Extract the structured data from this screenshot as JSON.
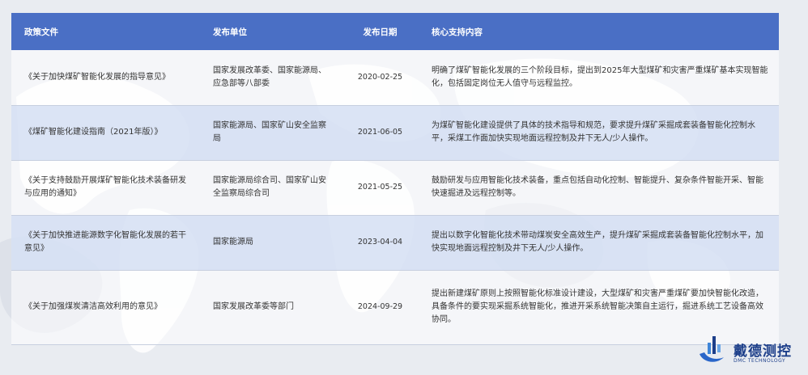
{
  "table": {
    "headers": {
      "policy": "政策文件",
      "issuer": "发布单位",
      "date": "发布日期",
      "content": "核心支持内容"
    },
    "rows": [
      {
        "policy": "《关于加快煤矿智能化发展的指导意见》",
        "issuer": "国家发展改革委、国家能源局、应急部等八部委",
        "date": "2020-02-25",
        "content": "明确了煤矿智能化发展的三个阶段目标，提出到2025年大型煤矿和灾害严重煤矿基本实现智能化，包括固定岗位无人值守与远程监控。"
      },
      {
        "policy": "《煤矿智能化建设指南（2021年版）》",
        "issuer": "国家能源局、国家矿山安全监察局",
        "date": "2021-06-05",
        "content": "为煤矿智能化建设提供了具体的技术指导和规范，要求提升煤矿采掘成套装备智能化控制水平，采煤工作面加快实现地面远程控制及井下无人/少人操作。"
      },
      {
        "policy": "《关于支持鼓励开展煤矿智能化技术装备研发与应用的通知》",
        "issuer": "国家能源局综合司、国家矿山安全监察局综合司",
        "date": "2021-05-25",
        "content": "鼓励研发与应用智能化技术装备，重点包括自动化控制、智能提升、复杂条件智能开采、智能快速掘进及远程控制等。"
      },
      {
        "policy": "《关于加快推进能源数字化智能化发展的若干意见》",
        "issuer": "国家能源局",
        "date": "2023-04-04",
        "content": "提出以数字化智能化技术带动煤炭安全高效生产，提升煤矿采掘成套装备智能化控制水平，加快实现地面远程控制及井下无人/少人操作。"
      },
      {
        "policy": "《关于加强煤炭清洁高效利用的意见》",
        "issuer": "国家发展改革委等部门",
        "date": "2024-09-29",
        "content": "提出新建煤矿原则上按照智能化标准设计建设，大型煤矿和灾害严重煤矿要加快智能化改造，具备条件的要实现采掘系统智能化，推进开采系统智能决策自主运行，掘进系统工艺设备高效协同。"
      }
    ]
  },
  "logo": {
    "name": "戴德测控",
    "subtitle": "DMC TECHNOLOGY"
  },
  "colors": {
    "header_bg": "#4a6fc5",
    "row_alt_bg": "#d6e0f4",
    "logo": "#1d3f8a"
  }
}
